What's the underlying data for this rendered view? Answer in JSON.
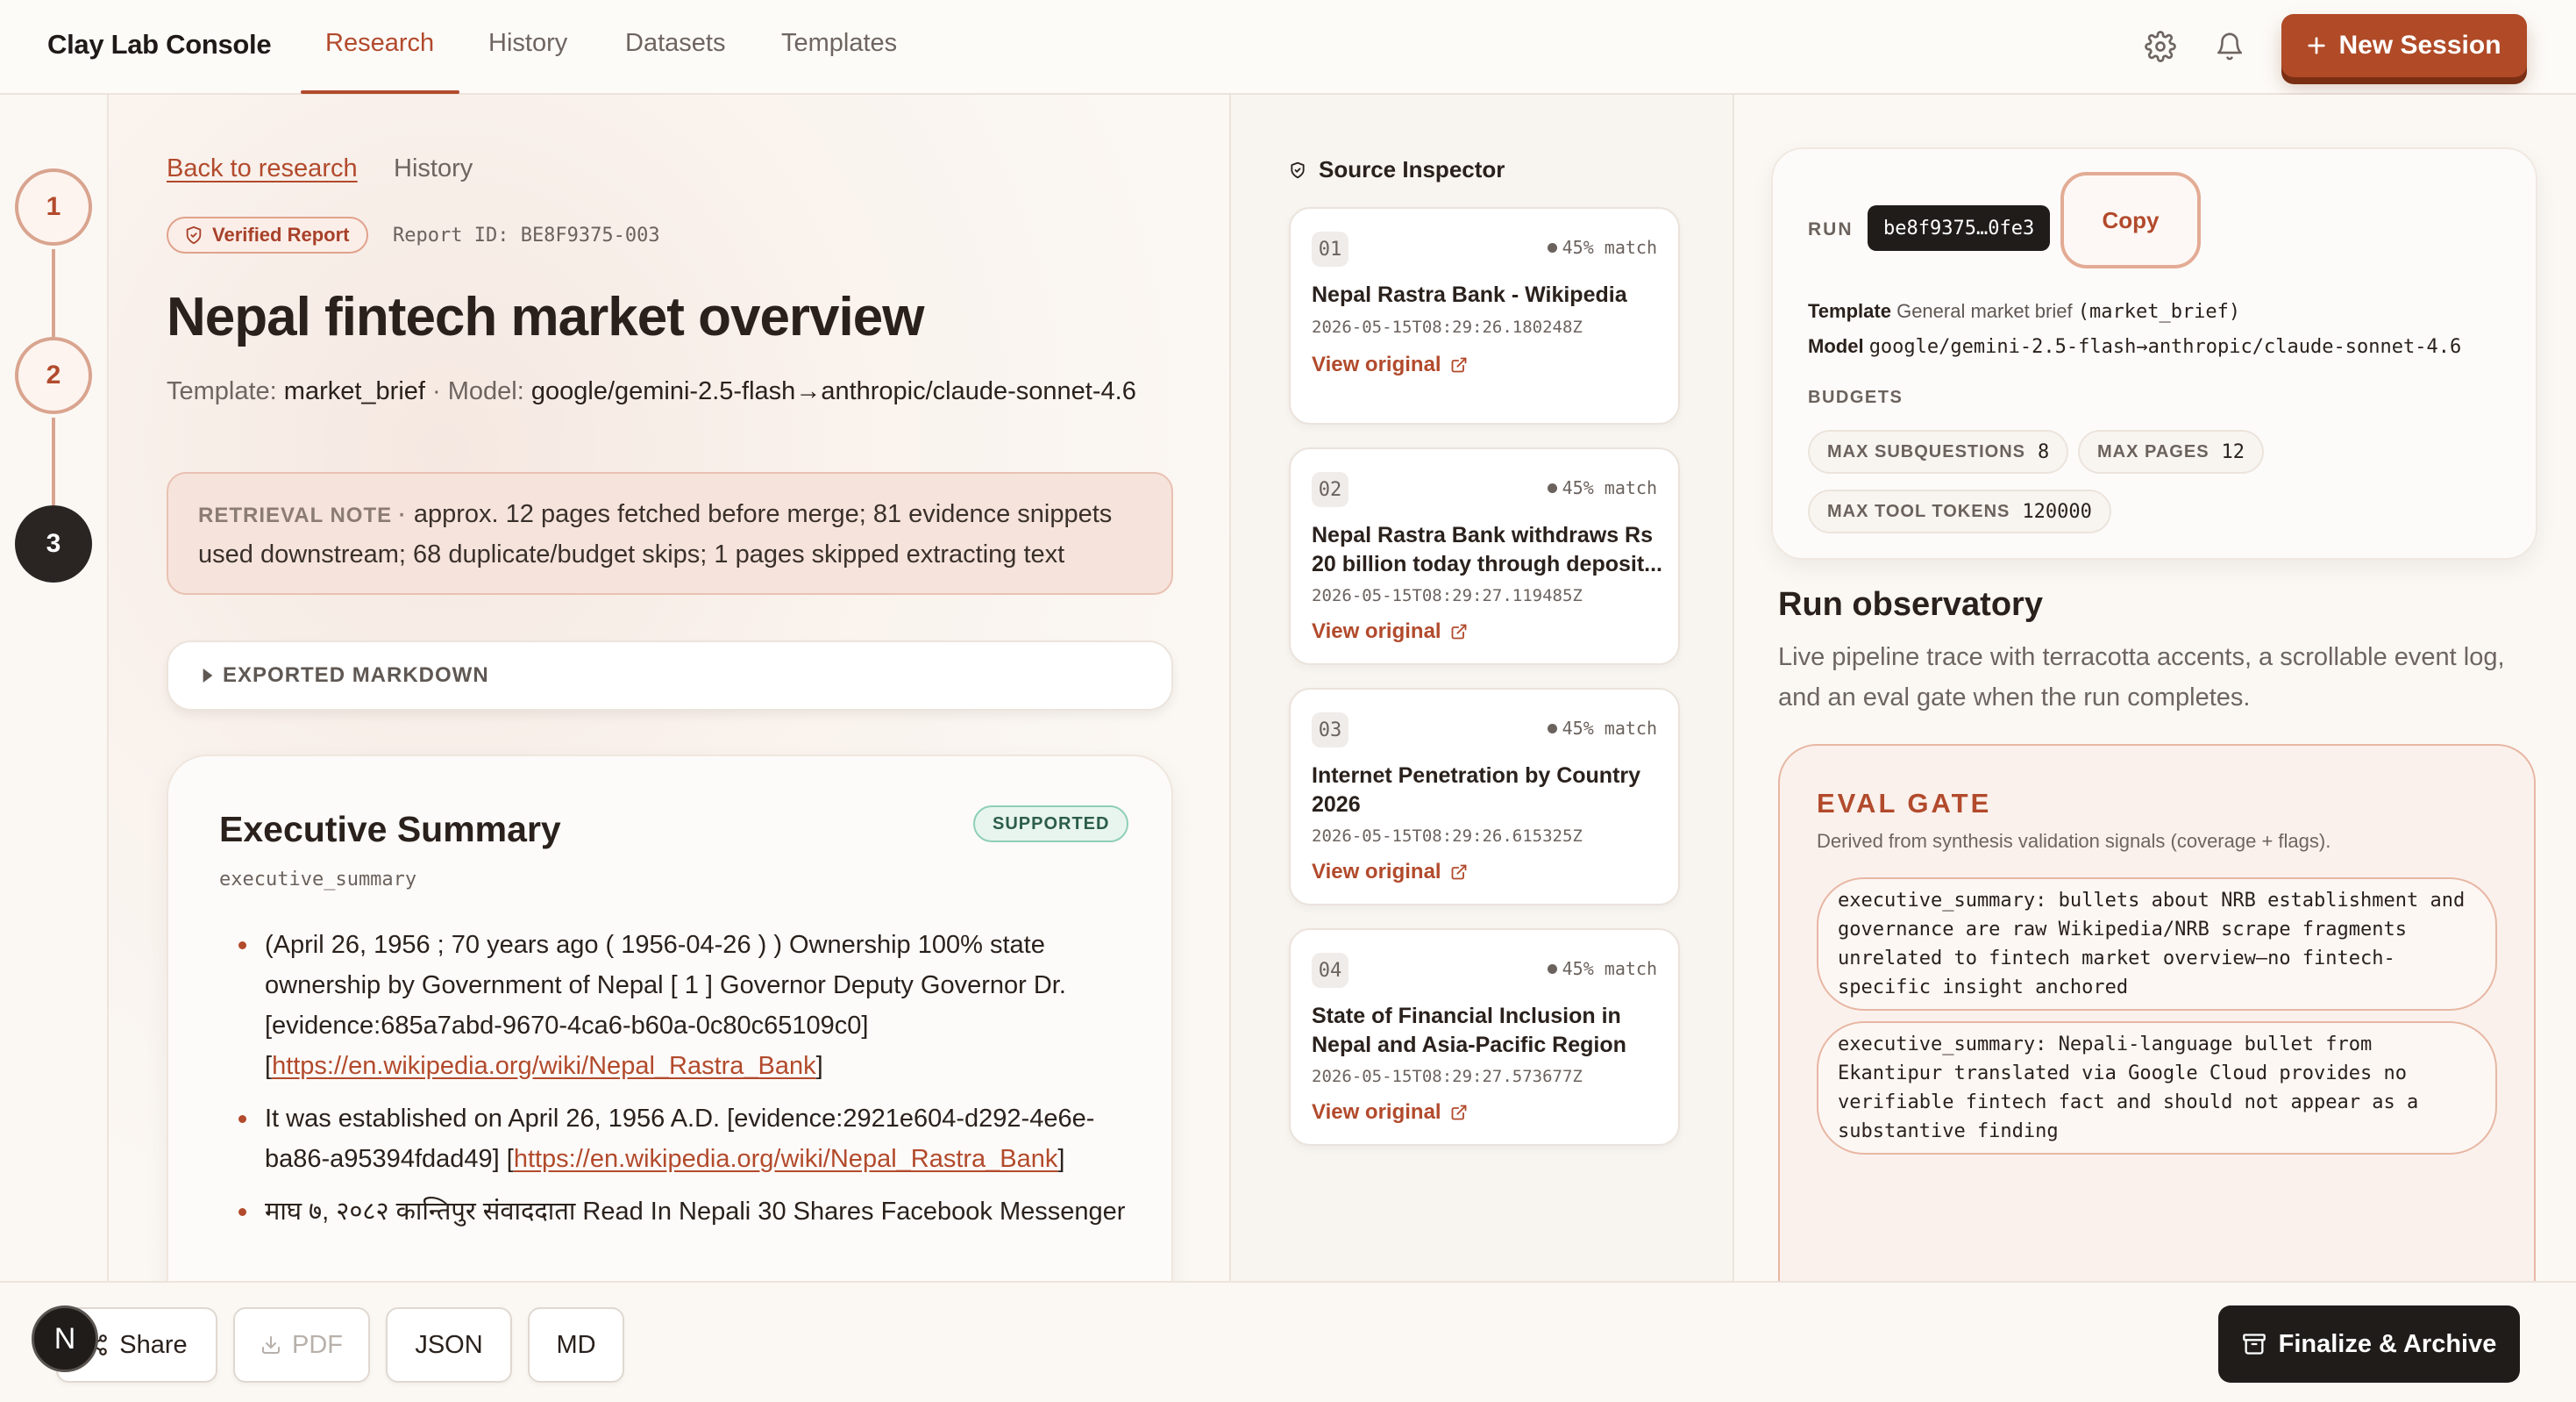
{
  "app": {
    "brand": "Clay Lab Console",
    "nav_tabs": [
      "Research",
      "History",
      "Datasets",
      "Templates"
    ],
    "active_tab": "Research",
    "new_session_label": "New Session",
    "accent_color": "#b24a2c"
  },
  "stepper": {
    "steps": [
      "1",
      "2",
      "3"
    ],
    "current": "3"
  },
  "report": {
    "back_label": "Back to research",
    "history_label": "History",
    "verified_label": "Verified Report",
    "report_id": "Report ID: BE8F9375-003",
    "title": "Nepal fintech market overview",
    "template_prefix": "Template:",
    "template_value": "market_brief",
    "model_prefix": "· Model:",
    "model_value": "google/gemini-2.5-flash→anthropic/claude-sonnet-4.6",
    "retrieval_note_label": "RETRIEVAL NOTE ·",
    "retrieval_note_text": "approx. 12 pages fetched before merge; 81 evidence snippets used downstream; 68 duplicate/budget skips; 1 pages skipped extracting text",
    "exported_markdown_label": "EXPORTED MARKDOWN",
    "summary": {
      "title": "Executive Summary",
      "status": "SUPPORTED",
      "key": "executive_summary",
      "bullets": [
        {
          "text": "(April 26, 1956 ; 70 years ago ( 1956-04-26 ) ) Ownership 100% state ownership by Government of Nepal [ 1 ] Governor Deputy Governor Dr. [evidence:685a7abd-9670-4ca6-b60a-0c80c65109c0] [",
          "link": "https://en.wikipedia.org/wiki/Nepal_Rastra_Bank",
          "suffix": "]"
        },
        {
          "text": "It was established on April 26, 1956 A.D. [evidence:2921e604-d292-4e6e-ba86-a95394fdad49] [",
          "link": "https://en.wikipedia.org/wiki/Nepal_Rastra_Bank",
          "suffix": "]"
        },
        {
          "text": "माघ ७, २०८२ कान्तिपुर संवाददाता Read In Nepali 30 Shares Facebook Messenger"
        }
      ]
    }
  },
  "inspector": {
    "title": "Source Inspector",
    "link_label": "View original",
    "sources": [
      {
        "num": "01",
        "match": "45% match",
        "title": "Nepal Rastra Bank - Wikipedia",
        "date": "2026-05-15T08:29:26.180248Z"
      },
      {
        "num": "02",
        "match": "45% match",
        "title": "Nepal Rastra Bank withdraws Rs 20 billion today through deposit...",
        "date": "2026-05-15T08:29:27.119485Z"
      },
      {
        "num": "03",
        "match": "45% match",
        "title": "Internet Penetration by Country 2026",
        "date": "2026-05-15T08:29:26.615325Z"
      },
      {
        "num": "04",
        "match": "45% match",
        "title": "State of Financial Inclusion in Nepal and Asia-Pacific Region",
        "date": "2026-05-15T08:29:27.573677Z"
      }
    ]
  },
  "run": {
    "label": "RUN",
    "hash": "be8f9375…0fe3",
    "copy_label": "Copy",
    "template_label": "Template",
    "template_name": "General market brief",
    "template_code": "(market_brief)",
    "model_label": "Model",
    "model_value": "google/gemini-2.5-flash→anthropic/claude-sonnet-4.6",
    "budgets_label": "BUDGETS",
    "budgets": [
      {
        "label": "MAX SUBQUESTIONS",
        "value": "8"
      },
      {
        "label": "MAX PAGES",
        "value": "12"
      },
      {
        "label": "MAX TOOL TOKENS",
        "value": "120000"
      }
    ]
  },
  "observatory": {
    "title": "Run observatory",
    "description": "Live pipeline trace with terracotta accents, a scrollable event log, and an eval gate when the run completes.",
    "eval_title": "EVAL GATE",
    "eval_subtitle": "Derived from synthesis validation signals (coverage + flags).",
    "eval_items": [
      "executive_summary: bullets about NRB establishment and governance are raw Wikipedia/NRB scrape fragments unrelated to fintech market overview—no fintech-specific insight anchored",
      "executive_summary: Nepali-language bullet from Ekantipur translated via Google Cloud provides no verifiable fintech fact and should not appear as a substantive finding"
    ]
  },
  "bottom": {
    "avatar_letter": "N",
    "share_label": "Share",
    "pdf_label": "PDF",
    "json_label": "JSON",
    "md_label": "MD",
    "finalize_label": "Finalize & Archive"
  }
}
